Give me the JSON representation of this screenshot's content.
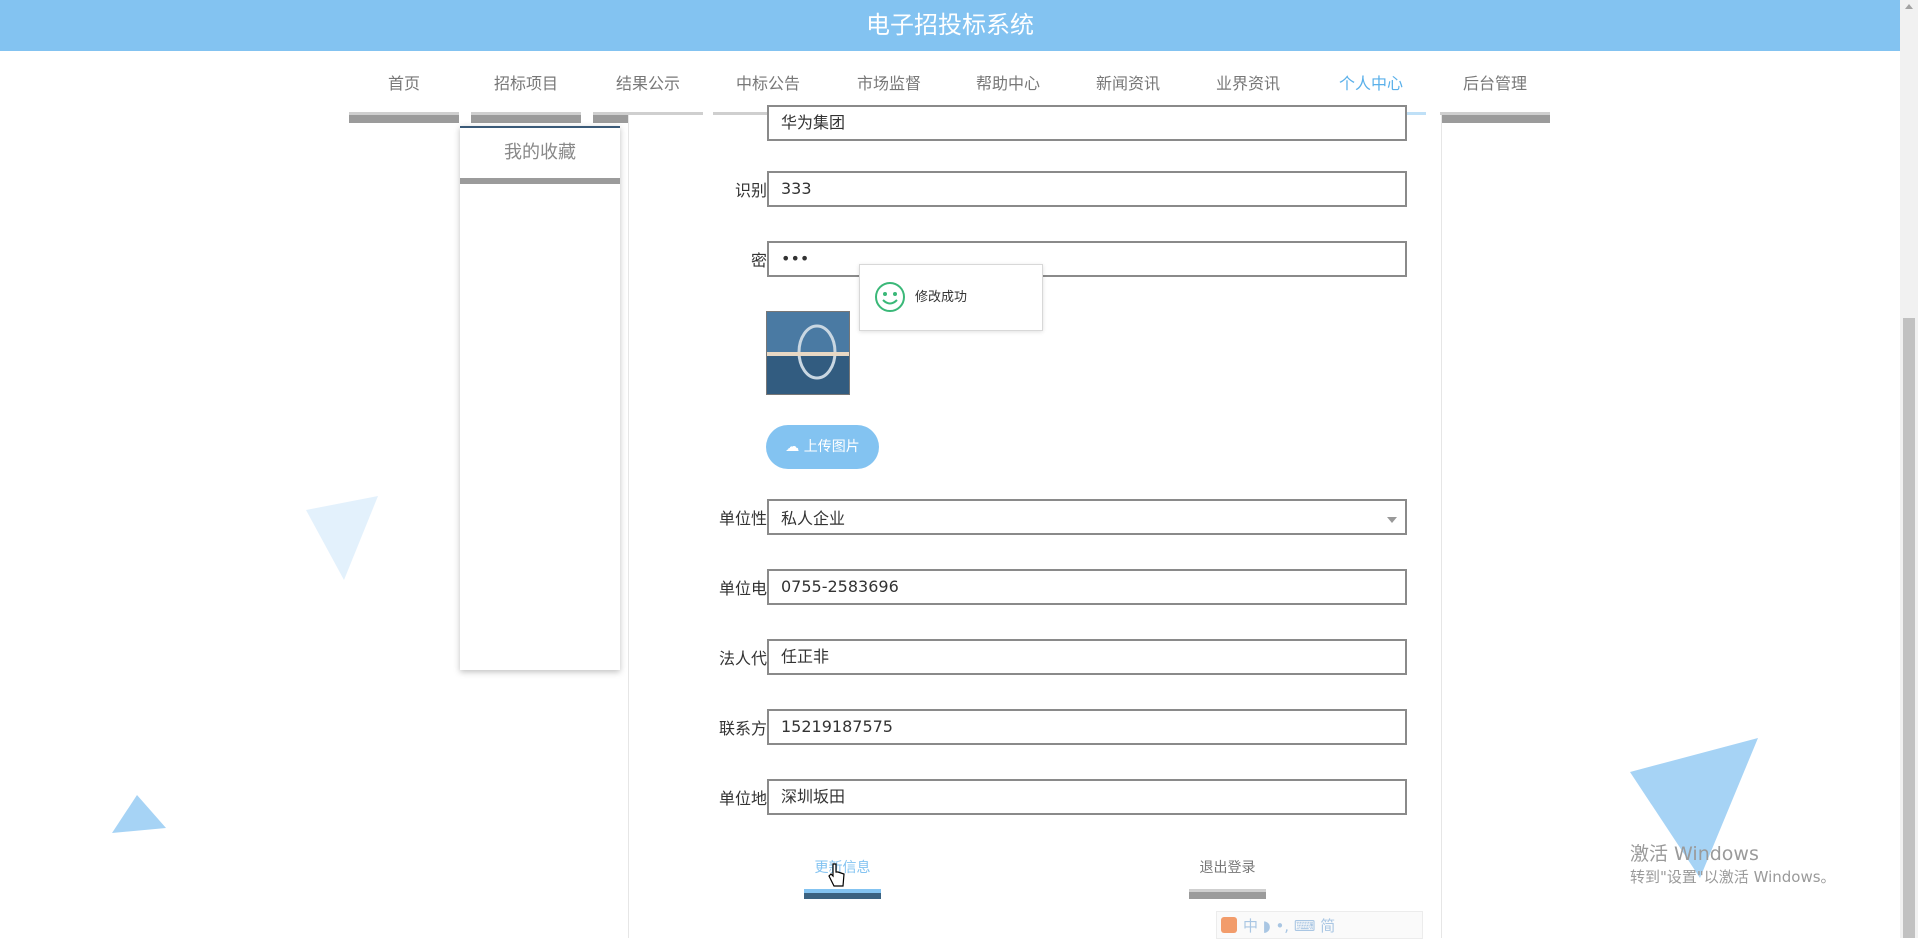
{
  "header": {
    "title": "电子招投标系统"
  },
  "nav": {
    "items": [
      {
        "label": "首页"
      },
      {
        "label": "招标项目"
      },
      {
        "label": "结果公示"
      },
      {
        "label": "中标公告"
      },
      {
        "label": "市场监督"
      },
      {
        "label": "帮助中心"
      },
      {
        "label": "新闻资讯"
      },
      {
        "label": "业界资讯"
      },
      {
        "label": "个人中心"
      },
      {
        "label": "后台管理"
      }
    ],
    "active": "个人中心"
  },
  "sidebar": {
    "items": [
      {
        "label": "我的收藏"
      }
    ]
  },
  "form": {
    "company_name": {
      "value": "华为集团"
    },
    "id_code": {
      "label": "识别码",
      "value": "333"
    },
    "password": {
      "label": "密码",
      "value": "•••"
    },
    "upload_label": "上传图片",
    "nature": {
      "label": "单位性质",
      "value": "私人企业"
    },
    "phone": {
      "label": "单位电话",
      "value": "0755-2583696"
    },
    "legal_rep": {
      "label": "法人代表",
      "value": "任正非"
    },
    "contact": {
      "label": "联系方式",
      "value": "15219187575"
    },
    "address": {
      "label": "单位地址",
      "value": "深圳坂田"
    }
  },
  "buttons": {
    "update": "更新信息",
    "logout": "退出登录"
  },
  "toast": {
    "message": "修改成功",
    "icon": "smiley-icon"
  },
  "watermark": {
    "line1": "激活 Windows",
    "line2": "转到\"设置\"以激活 Windows。"
  },
  "ime": {
    "chars": "中 ◗ •, ⌨ 简"
  },
  "colors": {
    "primary": "#83c3f1",
    "nav_text": "#777777",
    "active_text": "#5ab0ea",
    "bar_gray": "#9b9b9b"
  }
}
